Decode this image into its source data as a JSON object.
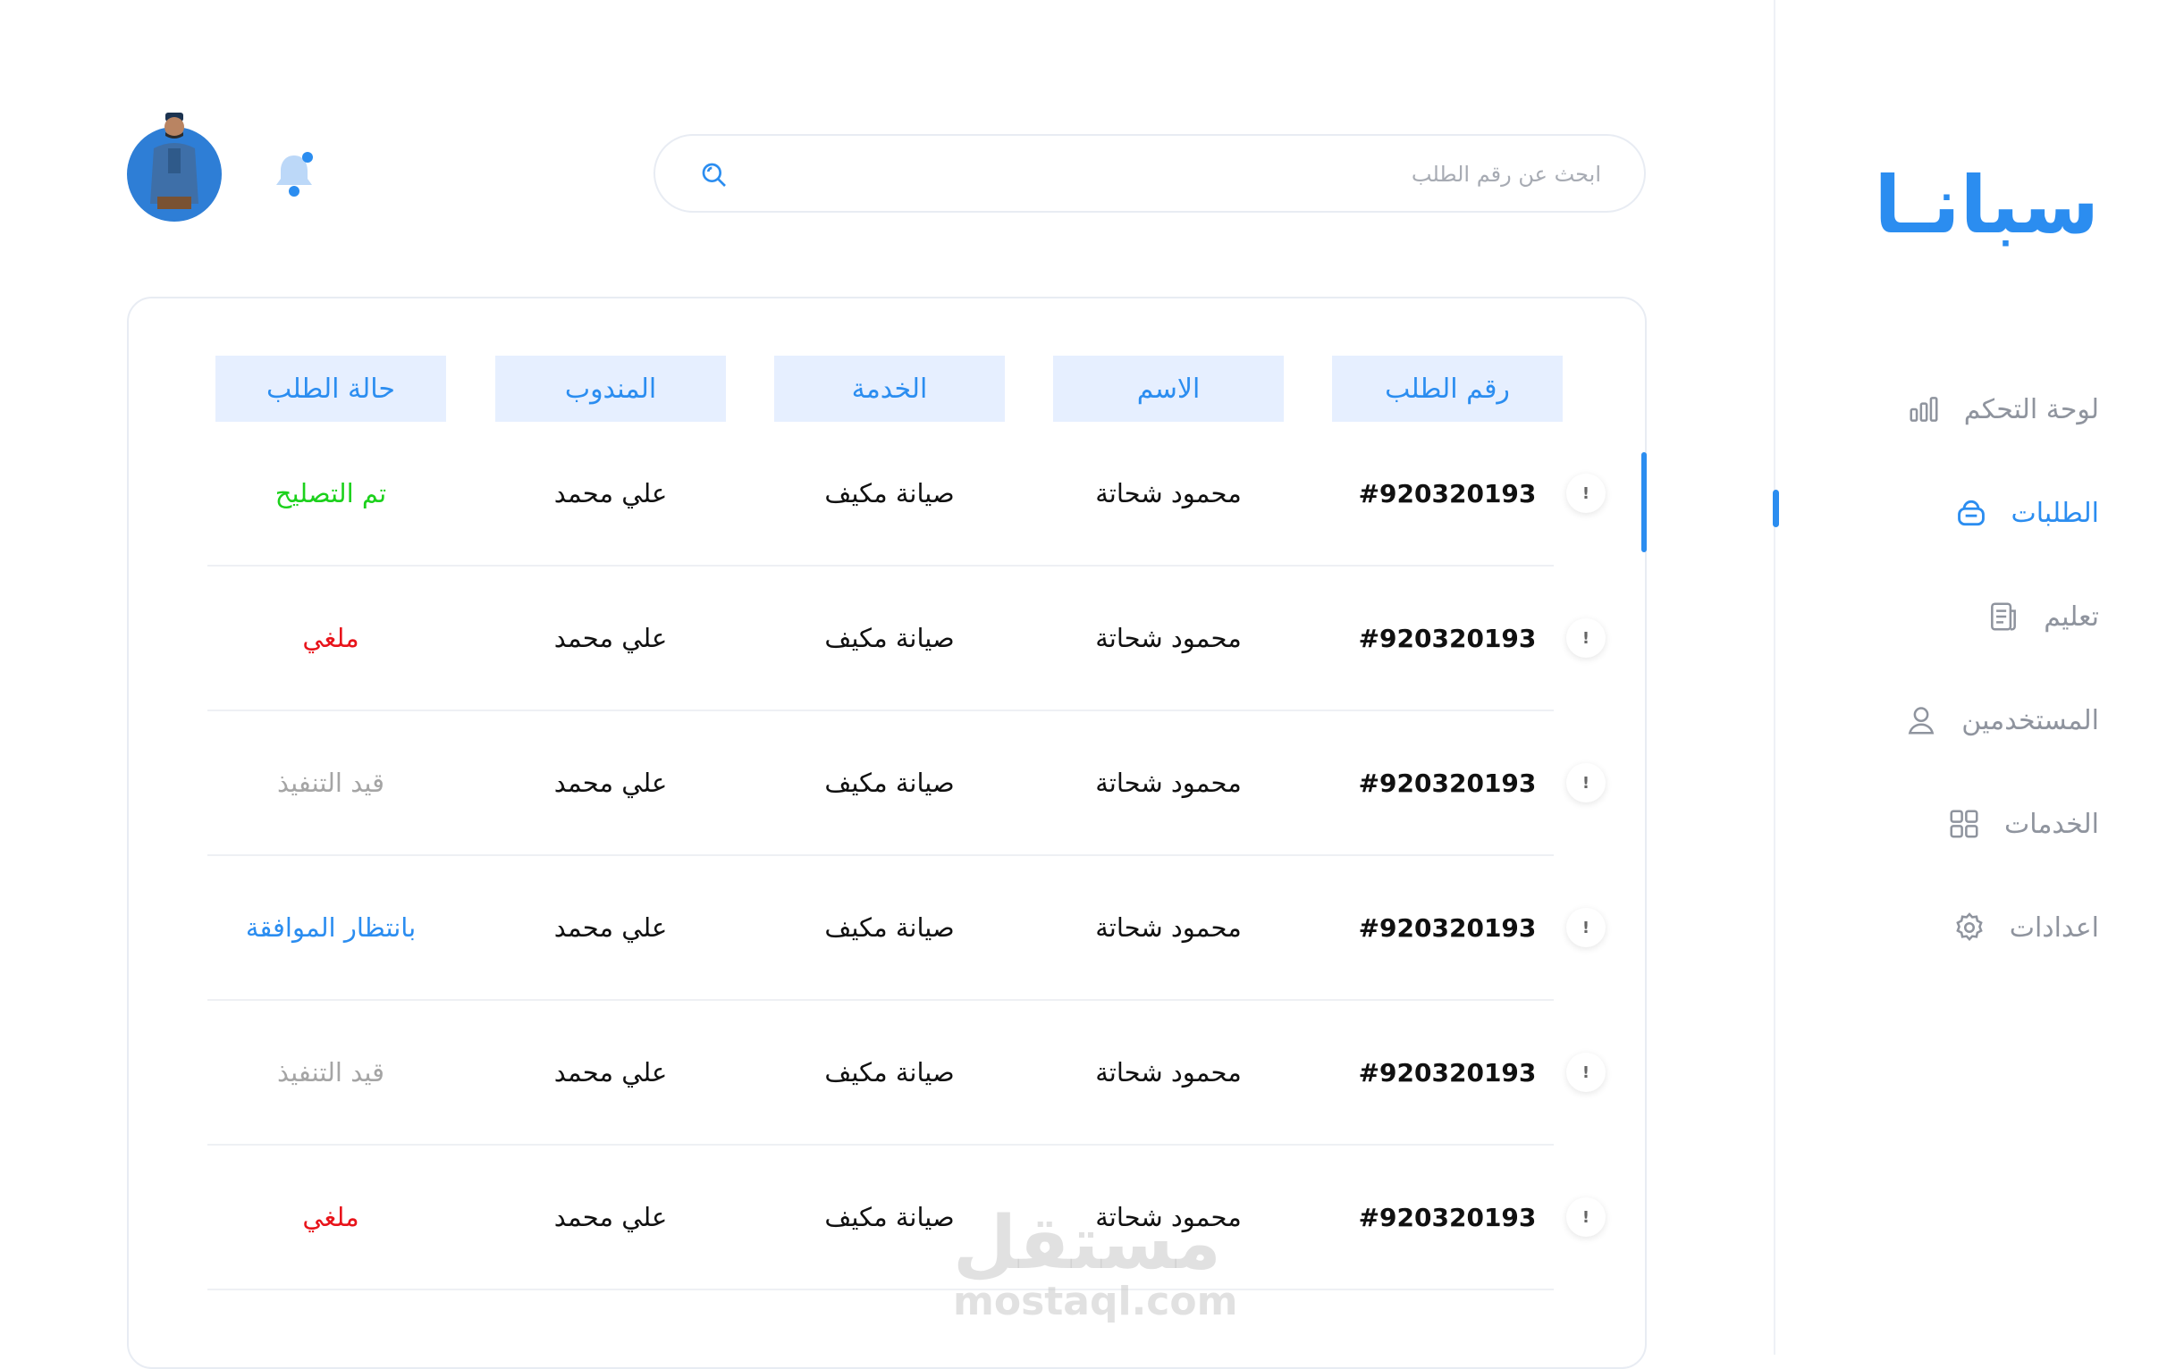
{
  "brand": {
    "logo_text": "سبانـا"
  },
  "sidebar": {
    "items": [
      {
        "label": "لوحة التحكم",
        "icon": "bar-chart-icon",
        "active": false
      },
      {
        "label": "الطلبات",
        "icon": "basket-icon",
        "active": true
      },
      {
        "label": "تعليم",
        "icon": "document-icon",
        "active": false
      },
      {
        "label": "المستخدمين",
        "icon": "user-icon",
        "active": false
      },
      {
        "label": "الخدمات",
        "icon": "grid-icon",
        "active": false
      },
      {
        "label": "اعدادات",
        "icon": "gear-icon",
        "active": false
      }
    ]
  },
  "header": {
    "search_placeholder": "ابحث عن رقم الطلب"
  },
  "table": {
    "headers": {
      "order_no": "رقم الطلب",
      "name": "الاسم",
      "service": "الخدمة",
      "agent": "المندوب",
      "status": "حالة الطلب"
    },
    "rows": [
      {
        "order_no": "#920320193",
        "name": "محمود شحاتة",
        "service": "صيانة مكيف",
        "agent": "علي محمد",
        "status": "تم التصليح"
      },
      {
        "order_no": "#920320193",
        "name": "محمود شحاتة",
        "service": "صيانة مكيف",
        "agent": "علي محمد",
        "status": "ملغي"
      },
      {
        "order_no": "#920320193",
        "name": "محمود شحاتة",
        "service": "صيانة مكيف",
        "agent": "علي محمد",
        "status": "قيد التنفيذ"
      },
      {
        "order_no": "#920320193",
        "name": "محمود شحاتة",
        "service": "صيانة مكيف",
        "agent": "علي محمد",
        "status": "بانتظار الموافقة"
      },
      {
        "order_no": "#920320193",
        "name": "محمود شحاتة",
        "service": "صيانة مكيف",
        "agent": "علي محمد",
        "status": "قيد التنفيذ"
      },
      {
        "order_no": "#920320193",
        "name": "محمود شحاتة",
        "service": "صيانة مكيف",
        "agent": "علي محمد",
        "status": "ملغي"
      }
    ],
    "info_symbol": "!"
  },
  "colors": {
    "accent": "#2b8df0",
    "status_done": "#1cd11c",
    "status_cancelled": "#e8141b",
    "status_in_progress": "#a5a5a5",
    "status_pending": "#2b8df0"
  },
  "watermark": {
    "arabic": "مستقل",
    "latin": "mostaql.com"
  }
}
